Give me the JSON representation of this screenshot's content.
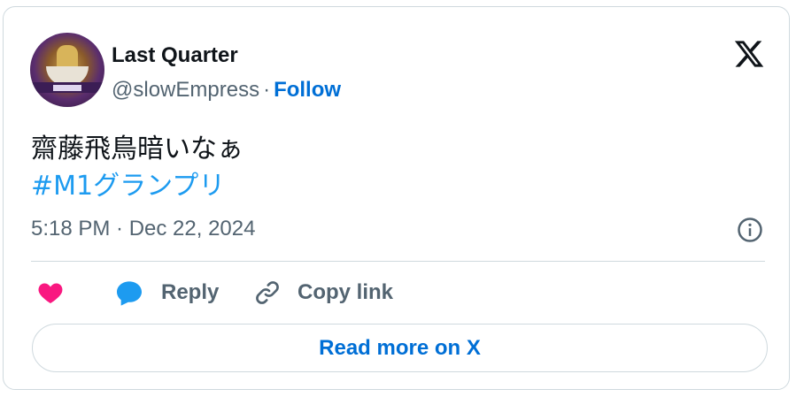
{
  "author": {
    "display_name": "Last Quarter",
    "handle": "@slowEmpress",
    "separator": "·",
    "follow_label": "Follow"
  },
  "tweet": {
    "text_line1": "齋藤飛鳥暗いなぁ",
    "hashtag": "#M1グランプリ",
    "timestamp": "5:18 PM · Dec 22, 2024"
  },
  "actions": {
    "reply_label": "Reply",
    "copy_link_label": "Copy link",
    "read_more_label": "Read more on X"
  },
  "icons": {
    "logo": "x-logo-icon",
    "info": "info-icon",
    "like": "heart-icon",
    "reply": "reply-bubble-icon",
    "copy": "link-icon"
  },
  "colors": {
    "follow_link": "#006fd6",
    "hashtag": "#1d9bf0",
    "like": "#f91880",
    "reply": "#1d9bf0",
    "secondary_text": "#536471",
    "border": "#cfd9de"
  }
}
